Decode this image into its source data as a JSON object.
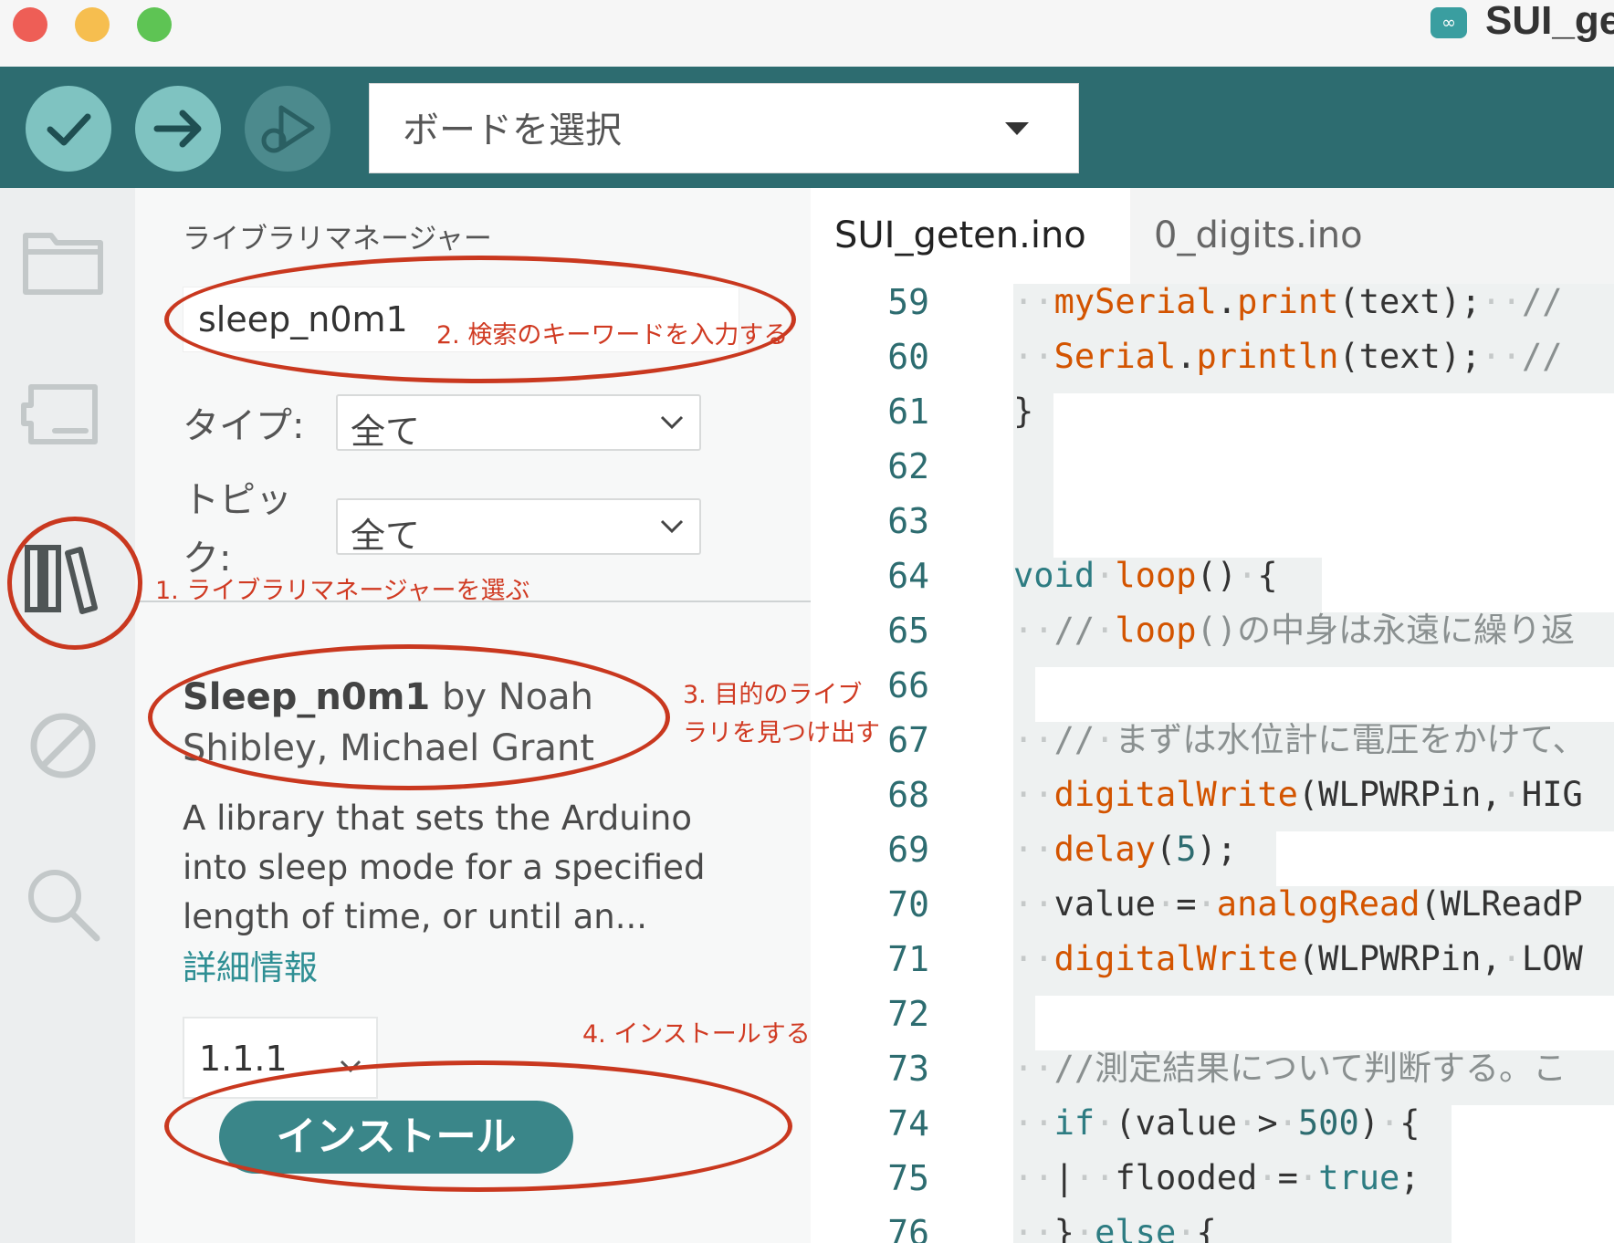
{
  "window": {
    "title": "SUI_ge",
    "traffic_lights": {
      "close": "#ee5e56",
      "minimize": "#f6be4f",
      "maximize": "#5ec454"
    }
  },
  "toolbar": {
    "verify_icon": "check-icon",
    "upload_icon": "arrow-right-icon",
    "debug_icon": "debug-icon",
    "board_select_label": "ボードを選択",
    "accent_color": "#2d6c70"
  },
  "sidebar": {
    "items": [
      {
        "name": "sketchbook",
        "icon": "folder-icon"
      },
      {
        "name": "boards-manager",
        "icon": "board-icon"
      },
      {
        "name": "library-manager",
        "icon": "library-icon",
        "active": true
      },
      {
        "name": "debug",
        "icon": "no-entry-icon"
      },
      {
        "name": "search",
        "icon": "search-icon"
      }
    ]
  },
  "library_manager": {
    "title": "ライブラリマネージャー",
    "search_value": "sleep_n0m1",
    "type_label": "タイプ:",
    "type_value": "全て",
    "topic_label": "トピッ\nク:",
    "topic_value": "全て",
    "result": {
      "name": "Sleep_n0m1",
      "by": "by Noah Shibley, Michael Grant",
      "description": "A library that sets the Arduino into sleep mode for a specified length of time, or until an...",
      "more_info": "詳細情報",
      "version": "1.1.1",
      "install_label": "インストール"
    }
  },
  "editor": {
    "tabs": [
      "SUI_geten.ino",
      "0_digits.ino"
    ],
    "line_numbers": [
      "59",
      "60",
      "61",
      "62",
      "63",
      "64",
      "65",
      "66",
      "67",
      "68",
      "69",
      "70",
      "71",
      "72",
      "73",
      "74",
      "75",
      "76"
    ],
    "code_lines": [
      "··mySerial.print(text);··//",
      "··Serial.println(text);··//",
      "}",
      "",
      "",
      "void·loop()·{",
      "··//·loop()の中身は永遠に繰り返",
      "",
      "··//·まずは水位計に電圧をかけて、",
      "··digitalWrite(WLPWRPin,·HIG",
      "··delay(5);",
      "··value·=·analogRead(WLReadP",
      "··digitalWrite(WLPWRPin,·LOW",
      "",
      "··//測定結果について判断する。こ",
      "··if·(value·>·500)·{",
      "··|··flooded·=·true;",
      "··}·else·{"
    ]
  },
  "annotations": {
    "step1": "1. ライブラリマネージャーを選ぶ",
    "step2": "2. 検索のキーワードを入力する",
    "step3_line1": "3. 目的のライブ",
    "step3_line2": "ラリを見つけ出す",
    "step4": "4. インストールする",
    "color": "#d03a22"
  }
}
